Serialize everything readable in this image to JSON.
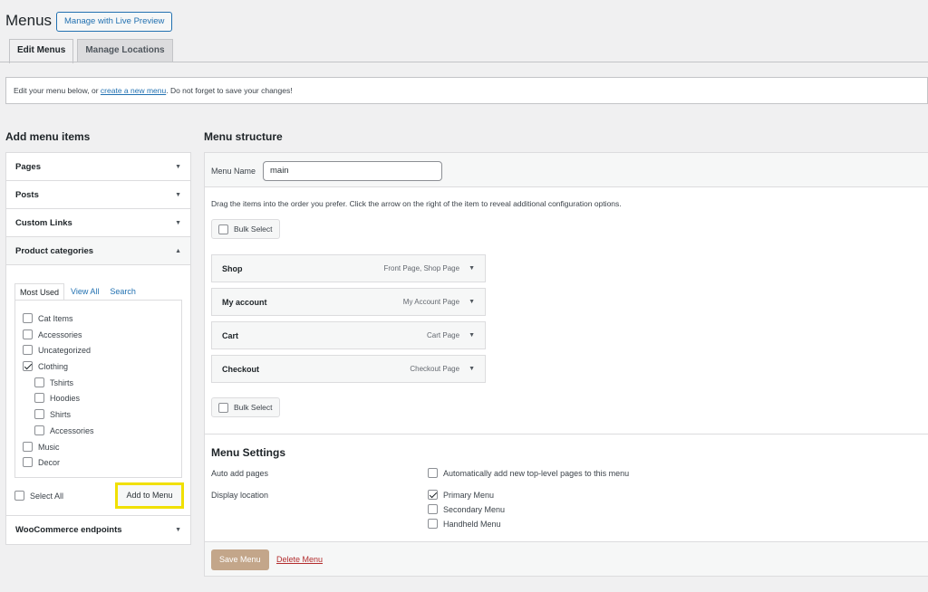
{
  "header": {
    "title": "Menus",
    "live_preview_label": "Manage with Live Preview"
  },
  "tabs": [
    {
      "label": "Edit Menus"
    },
    {
      "label": "Manage Locations"
    }
  ],
  "notice": {
    "before": "Edit your menu below, or ",
    "link": "create a new menu",
    "after": ". Do not forget to save your changes!"
  },
  "left": {
    "heading": "Add menu items",
    "sections": [
      {
        "label": "Pages"
      },
      {
        "label": "Posts"
      },
      {
        "label": "Custom Links"
      },
      {
        "label": "Product categories"
      },
      {
        "label": "WooCommerce endpoints"
      }
    ],
    "inner_tabs": [
      "Most Used",
      "View All",
      "Search"
    ],
    "categories": [
      {
        "label": "Cat Items",
        "checked": false,
        "level": 0
      },
      {
        "label": "Accessories",
        "checked": false,
        "level": 0
      },
      {
        "label": "Uncategorized",
        "checked": false,
        "level": 0
      },
      {
        "label": "Clothing",
        "checked": true,
        "level": 0
      },
      {
        "label": "Tshirts",
        "checked": false,
        "level": 1
      },
      {
        "label": "Hoodies",
        "checked": false,
        "level": 1
      },
      {
        "label": "Shirts",
        "checked": false,
        "level": 1
      },
      {
        "label": "Accessories",
        "checked": false,
        "level": 1
      },
      {
        "label": "Music",
        "checked": false,
        "level": 0
      },
      {
        "label": "Decor",
        "checked": false,
        "level": 0
      }
    ],
    "select_all_label": "Select All",
    "add_to_menu_label": "Add to Menu"
  },
  "right": {
    "heading": "Menu structure",
    "menu_name_label": "Menu Name",
    "menu_name_value": "main",
    "instructions": "Drag the items into the order you prefer. Click the arrow on the right of the item to reveal additional configuration options.",
    "bulk_select_label": "Bulk Select",
    "items": [
      {
        "title": "Shop",
        "type": "Front Page, Shop Page"
      },
      {
        "title": "My account",
        "type": "My Account Page"
      },
      {
        "title": "Cart",
        "type": "Cart Page"
      },
      {
        "title": "Checkout",
        "type": "Checkout Page"
      }
    ],
    "settings": {
      "title": "Menu Settings",
      "auto_add_label": "Auto add pages",
      "auto_add_option": "Automatically add new top-level pages to this menu",
      "auto_add_checked": false,
      "display_location_label": "Display location",
      "locations": [
        {
          "label": "Primary Menu",
          "checked": true
        },
        {
          "label": "Secondary Menu",
          "checked": false
        },
        {
          "label": "Handheld Menu",
          "checked": false
        }
      ]
    },
    "save_label": "Save Menu",
    "delete_label": "Delete Menu"
  },
  "colors": {
    "accent": "#2271b1",
    "highlight": "#f0e000",
    "save_button": "#c3a68a",
    "delete_link": "#b32d2e"
  }
}
